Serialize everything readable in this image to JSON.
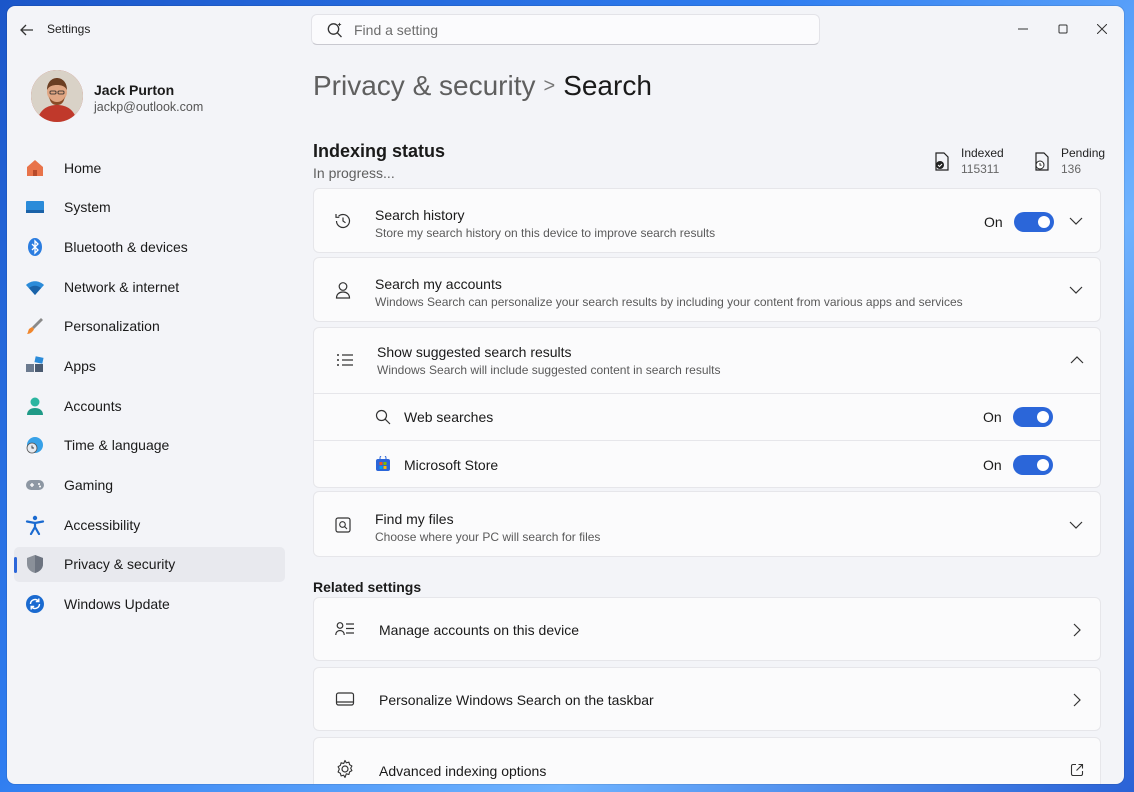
{
  "window": {
    "title": "Settings"
  },
  "search": {
    "placeholder": "Find a setting"
  },
  "profile": {
    "name": "Jack Purton",
    "email": "jackp@outlook.com"
  },
  "sidebar": {
    "items": [
      {
        "label": "Home",
        "icon": "home-icon"
      },
      {
        "label": "System",
        "icon": "system-icon"
      },
      {
        "label": "Bluetooth & devices",
        "icon": "bluetooth-icon"
      },
      {
        "label": "Network & internet",
        "icon": "wifi-icon"
      },
      {
        "label": "Personalization",
        "icon": "brush-icon"
      },
      {
        "label": "Apps",
        "icon": "apps-icon"
      },
      {
        "label": "Accounts",
        "icon": "accounts-icon"
      },
      {
        "label": "Time & language",
        "icon": "clock-globe-icon"
      },
      {
        "label": "Gaming",
        "icon": "gamepad-icon"
      },
      {
        "label": "Accessibility",
        "icon": "accessibility-icon"
      },
      {
        "label": "Privacy & security",
        "icon": "shield-icon",
        "selected": true
      },
      {
        "label": "Windows Update",
        "icon": "update-icon"
      }
    ]
  },
  "breadcrumb": {
    "parent": "Privacy & security",
    "separator": ">",
    "current": "Search"
  },
  "indexing": {
    "title": "Indexing status",
    "status": "In progress...",
    "indexed_label": "Indexed",
    "indexed_value": "115311",
    "pending_label": "Pending",
    "pending_value": "136"
  },
  "settings": {
    "search_history": {
      "title": "Search history",
      "desc": "Store my search history on this device to improve search results",
      "state": "On"
    },
    "search_accounts": {
      "title": "Search my accounts",
      "desc": "Windows Search can personalize your search results by including your content from various apps and services"
    },
    "suggested": {
      "title": "Show suggested search results",
      "desc": "Windows Search will include suggested content in search results",
      "web_label": "Web searches",
      "web_state": "On",
      "store_label": "Microsoft Store",
      "store_state": "On"
    },
    "find_files": {
      "title": "Find my files",
      "desc": "Choose where your PC will search for files"
    }
  },
  "related": {
    "heading": "Related settings",
    "manage_accounts": "Manage accounts on this device",
    "personalize_taskbar": "Personalize Windows Search on the taskbar",
    "advanced_indexing": "Advanced indexing options"
  },
  "colors": {
    "accent": "#2b66d9",
    "background": "#f3f4f8",
    "card": "#fbfbfc"
  }
}
